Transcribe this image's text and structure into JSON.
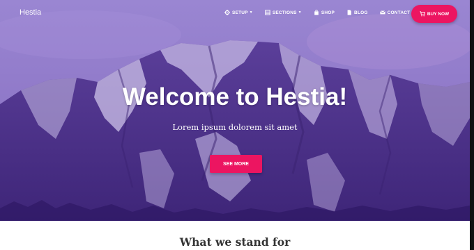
{
  "brand": "Hestia",
  "nav": {
    "items": [
      {
        "label": "SETUP",
        "icon": "gear-icon",
        "dropdown": true
      },
      {
        "label": "SECTIONS",
        "icon": "sections-icon",
        "dropdown": true
      },
      {
        "label": "SHOP",
        "icon": "bag-icon",
        "dropdown": false
      },
      {
        "label": "BLOG",
        "icon": "document-icon",
        "dropdown": false
      },
      {
        "label": "CONTACT",
        "icon": "envelope-icon",
        "dropdown": false
      }
    ],
    "buy_label": "BUY NOW"
  },
  "hero": {
    "title": "Welcome to Hestia!",
    "subtitle": "Lorem ipsum dolorem sit amet",
    "cta_label": "SEE MORE"
  },
  "section": {
    "title": "What we stand for"
  },
  "colors": {
    "accent": "#ec1561",
    "hero_overlay": "#6a4fb0"
  }
}
